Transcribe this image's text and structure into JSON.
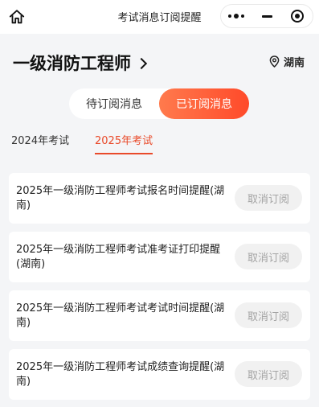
{
  "nav": {
    "title": "考试消息订阅提醒",
    "icons": [
      "home-icon",
      "more-dots-icon",
      "minimize-icon",
      "close-record-icon"
    ]
  },
  "header": {
    "title": "一级消防工程师",
    "region": "湖南"
  },
  "toggle": {
    "pending_label": "待订阅消息",
    "subscribed_label": "已订阅消息",
    "active": "subscribed"
  },
  "year_tabs": [
    {
      "label": "2024年考试",
      "active": false
    },
    {
      "label": "2025年考试",
      "active": true
    }
  ],
  "subscriptions": [
    {
      "title": "2025年一级消防工程师考试报名时间提醒(湖南)",
      "button": "取消订阅"
    },
    {
      "title": "2025年一级消防工程师考试准考证打印提醒(湖南)",
      "button": "取消订阅"
    },
    {
      "title": "2025年一级消防工程师考试考试时间提醒(湖南)",
      "button": "取消订阅"
    },
    {
      "title": "2025年一级消防工程师考试成绩查询提醒(湖南)",
      "button": "取消订阅"
    }
  ],
  "colors": {
    "accent": "#e94a2a",
    "toggle_gradient_start": "#ff7a4d",
    "toggle_gradient_end": "#ff4a2a",
    "page_bg": "#f4f5f7",
    "disabled_button_bg": "#f1f1f1",
    "disabled_button_text": "#a4a4a4"
  }
}
